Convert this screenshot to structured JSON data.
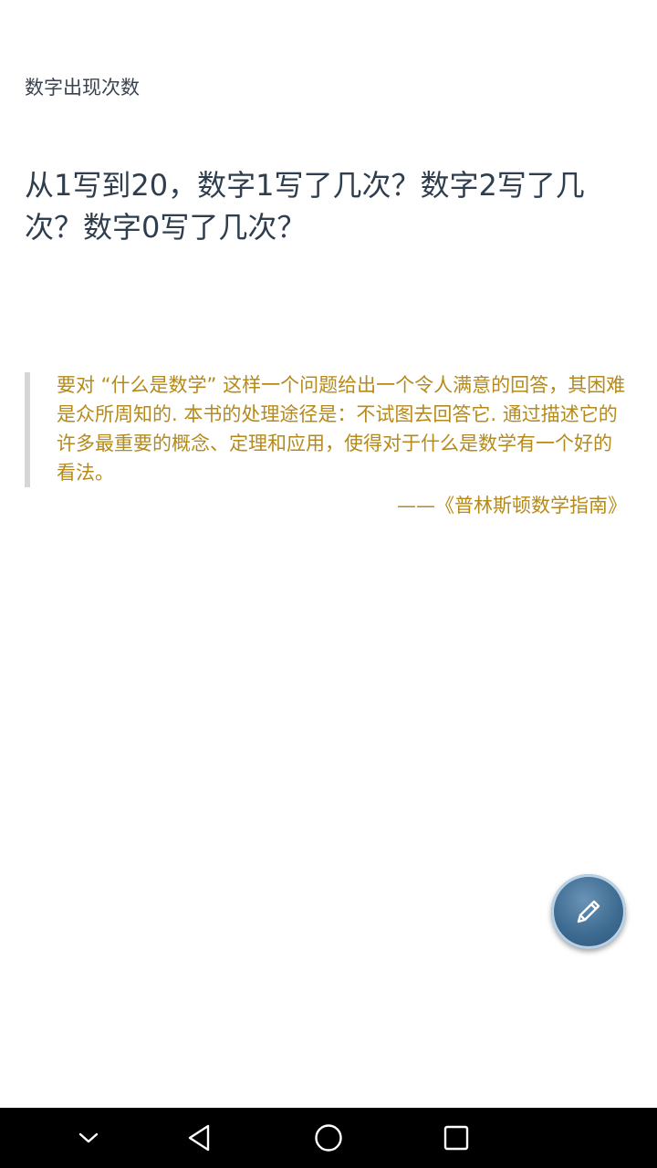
{
  "page": {
    "label": "数字出现次数",
    "question": "从1写到20，数字1写了几次？数字2写了几次？数字0写了几次？"
  },
  "quote": {
    "text": "要对 “什么是数学” 这样一个问题给出一个令人满意的回答，其困难是众所周知的. 本书的处理途径是：不试图去回答它. 通过描述它的许多最重要的概念、定理和应用，使得对于什么是数学有一个好的看法。",
    "source": "——《普林斯顿数学指南》",
    "color": "#b58a1a"
  },
  "fab": {
    "icon": "pencil-icon",
    "color": "#3d6a90"
  },
  "navbar": {
    "icons": [
      "chevron-down-icon",
      "back-icon",
      "home-icon",
      "recents-icon"
    ]
  }
}
